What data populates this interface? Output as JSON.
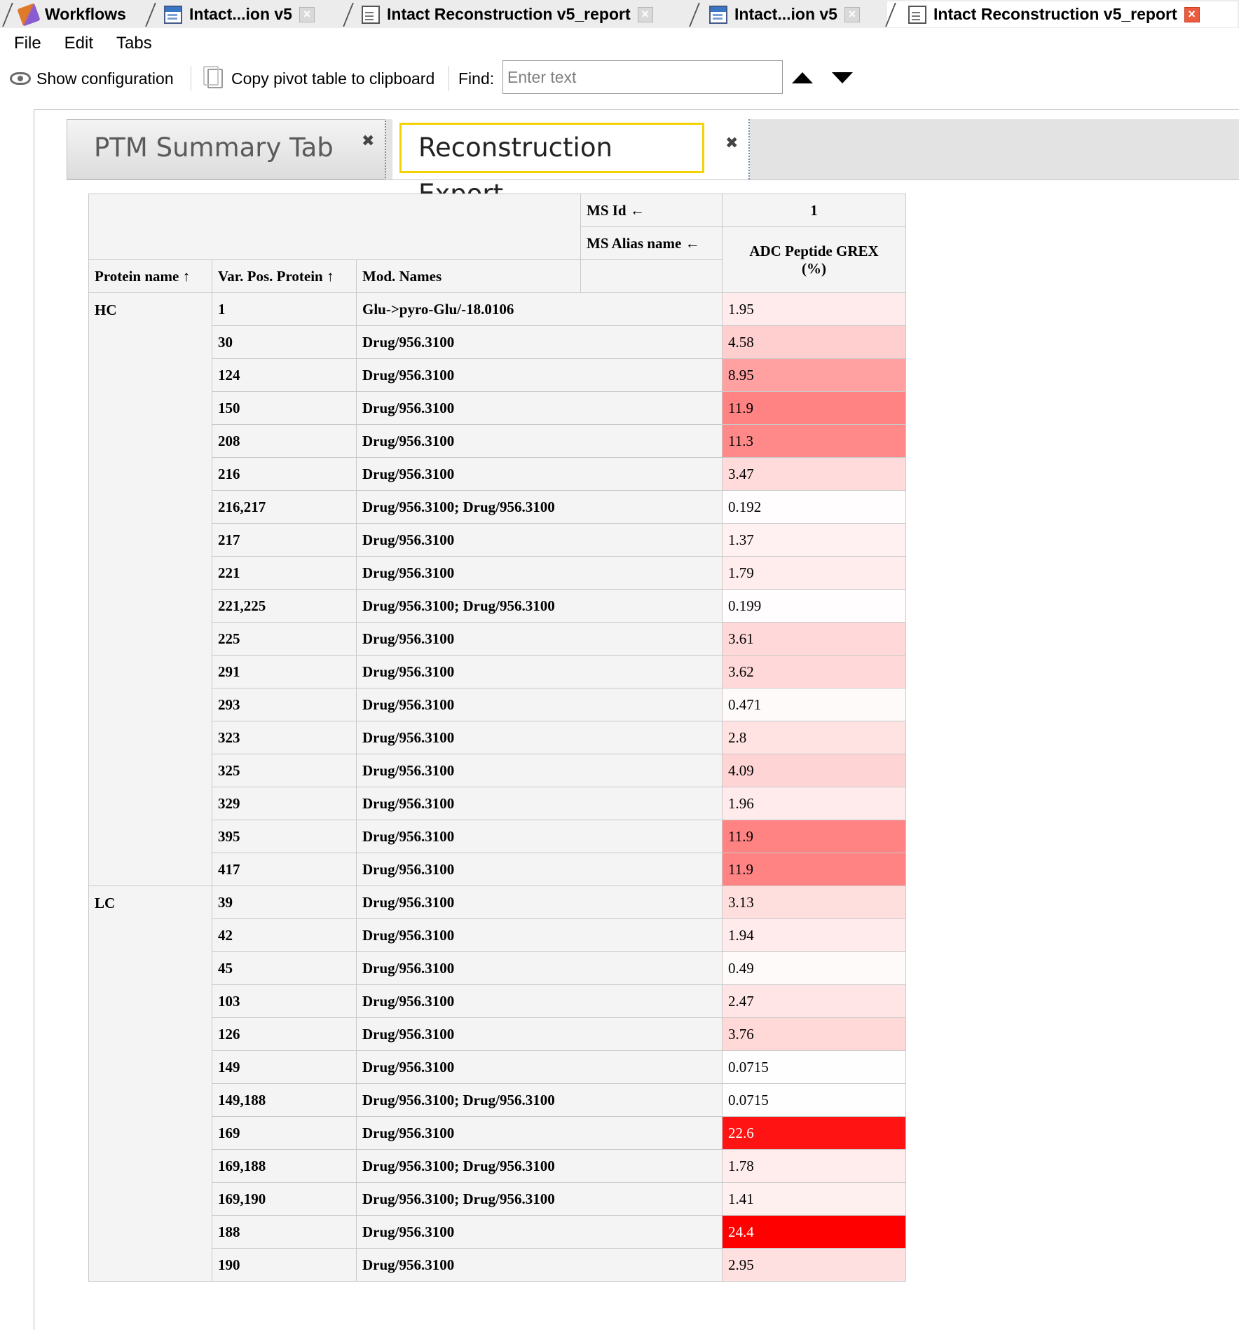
{
  "doc_tabs": [
    {
      "label": "Workflows",
      "icon": "workflow-icon",
      "closable": false
    },
    {
      "label": "Intact...ion v5",
      "icon": "window-icon",
      "closable": true
    },
    {
      "label": "Intact Reconstruction v5_report",
      "icon": "document-icon",
      "closable": true
    },
    {
      "label": "Intact...ion v5",
      "icon": "window-icon",
      "closable": true
    },
    {
      "label": "Intact Reconstruction v5_report",
      "icon": "document-icon",
      "closable": true,
      "active": true
    }
  ],
  "menu": [
    "File",
    "Edit",
    "Tabs"
  ],
  "toolbar": {
    "show_config": "Show configuration",
    "copy_pivot": "Copy pivot table to clipboard",
    "find_label": "Find:",
    "find_placeholder": "Enter text"
  },
  "view_tabs": [
    {
      "label": "PTM Summary Tab",
      "active": false
    },
    {
      "label": "Reconstruction Export",
      "active": true
    }
  ],
  "pivot": {
    "ms_id_label": "MS Id ←",
    "ms_id_value": "1",
    "ms_alias_label": "MS Alias name ←",
    "column_header": "ADC Peptide GREX (%)",
    "row_headers": [
      "Protein name ↑",
      "Var. Pos. Protein ↑",
      "Mod. Names"
    ],
    "groups": [
      {
        "protein": "HC",
        "rows": [
          {
            "pos": "1",
            "mod": "Glu->pyro-Glu/-18.0106",
            "value": "1.95"
          },
          {
            "pos": "30",
            "mod": "Drug/956.3100",
            "value": "4.58"
          },
          {
            "pos": "124",
            "mod": "Drug/956.3100",
            "value": "8.95"
          },
          {
            "pos": "150",
            "mod": "Drug/956.3100",
            "value": "11.9"
          },
          {
            "pos": "208",
            "mod": "Drug/956.3100",
            "value": "11.3"
          },
          {
            "pos": "216",
            "mod": "Drug/956.3100",
            "value": "3.47"
          },
          {
            "pos": "216,217",
            "mod": "Drug/956.3100; Drug/956.3100",
            "value": "0.192"
          },
          {
            "pos": "217",
            "mod": "Drug/956.3100",
            "value": "1.37"
          },
          {
            "pos": "221",
            "mod": "Drug/956.3100",
            "value": "1.79"
          },
          {
            "pos": "221,225",
            "mod": "Drug/956.3100; Drug/956.3100",
            "value": "0.199"
          },
          {
            "pos": "225",
            "mod": "Drug/956.3100",
            "value": "3.61"
          },
          {
            "pos": "291",
            "mod": "Drug/956.3100",
            "value": "3.62"
          },
          {
            "pos": "293",
            "mod": "Drug/956.3100",
            "value": "0.471"
          },
          {
            "pos": "323",
            "mod": "Drug/956.3100",
            "value": "2.8"
          },
          {
            "pos": "325",
            "mod": "Drug/956.3100",
            "value": "4.09"
          },
          {
            "pos": "329",
            "mod": "Drug/956.3100",
            "value": "1.96"
          },
          {
            "pos": "395",
            "mod": "Drug/956.3100",
            "value": "11.9"
          },
          {
            "pos": "417",
            "mod": "Drug/956.3100",
            "value": "11.9"
          }
        ]
      },
      {
        "protein": "LC",
        "rows": [
          {
            "pos": "39",
            "mod": "Drug/956.3100",
            "value": "3.13"
          },
          {
            "pos": "42",
            "mod": "Drug/956.3100",
            "value": "1.94"
          },
          {
            "pos": "45",
            "mod": "Drug/956.3100",
            "value": "0.49"
          },
          {
            "pos": "103",
            "mod": "Drug/956.3100",
            "value": "2.47"
          },
          {
            "pos": "126",
            "mod": "Drug/956.3100",
            "value": "3.76"
          },
          {
            "pos": "149",
            "mod": "Drug/956.3100",
            "value": "0.0715"
          },
          {
            "pos": "149,188",
            "mod": "Drug/956.3100; Drug/956.3100",
            "value": "0.0715"
          },
          {
            "pos": "169",
            "mod": "Drug/956.3100",
            "value": "22.6"
          },
          {
            "pos": "169,188",
            "mod": "Drug/956.3100; Drug/956.3100",
            "value": "1.78"
          },
          {
            "pos": "169,190",
            "mod": "Drug/956.3100; Drug/956.3100",
            "value": "1.41"
          },
          {
            "pos": "188",
            "mod": "Drug/956.3100",
            "value": "24.4"
          },
          {
            "pos": "190",
            "mod": "Drug/956.3100",
            "value": "2.95"
          }
        ]
      }
    ],
    "heat_color": "#ff0000",
    "heat_max": 24.4
  }
}
